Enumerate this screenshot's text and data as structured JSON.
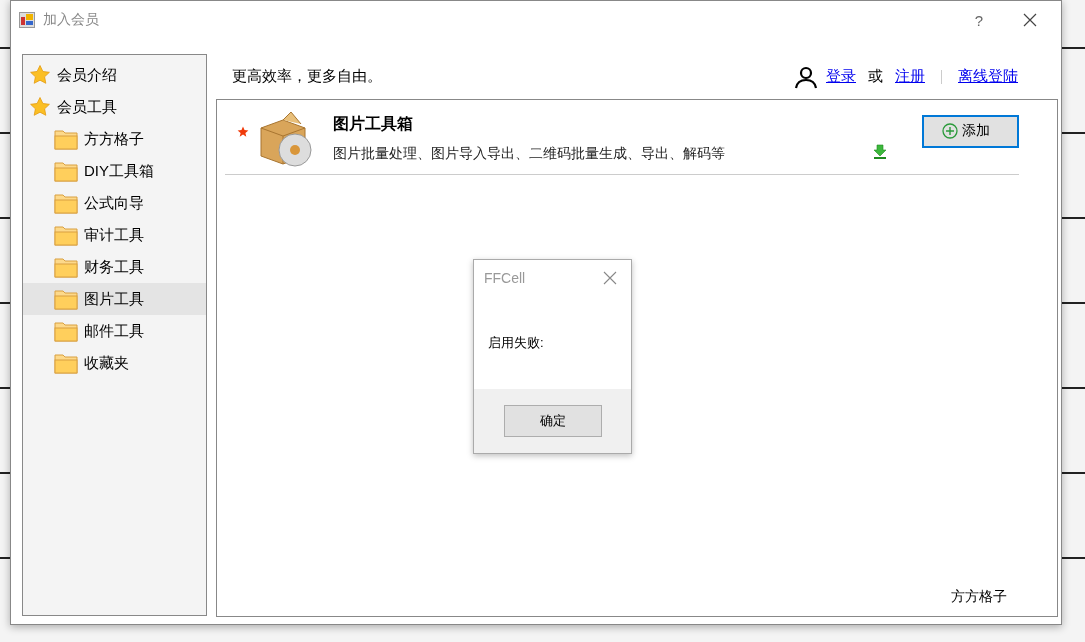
{
  "window": {
    "title": "加入会员",
    "help": "?"
  },
  "sidebar": {
    "items": [
      {
        "label": "会员介绍",
        "kind": "star",
        "selected": false
      },
      {
        "label": "会员工具",
        "kind": "star",
        "selected": false,
        "children": [
          {
            "label": "方方格子",
            "kind": "folder",
            "selected": false
          },
          {
            "label": "DIY工具箱",
            "kind": "folder",
            "selected": false
          },
          {
            "label": "公式向导",
            "kind": "folder",
            "selected": false
          },
          {
            "label": "审计工具",
            "kind": "folder",
            "selected": false
          },
          {
            "label": "财务工具",
            "kind": "folder",
            "selected": false
          },
          {
            "label": "图片工具",
            "kind": "folder",
            "selected": true
          },
          {
            "label": "邮件工具",
            "kind": "folder",
            "selected": false
          },
          {
            "label": "收藏夹",
            "kind": "folder",
            "selected": false
          }
        ]
      }
    ]
  },
  "header": {
    "slogan": "更高效率，更多自由。",
    "login": "登录",
    "or": "或",
    "register": "注册",
    "offline": "离线登陆"
  },
  "tools": [
    {
      "name": "图片工具箱",
      "description": "图片批量处理、图片导入导出、二维码批量生成、导出、解码等",
      "starred": true,
      "button": "添加"
    }
  ],
  "footer_label": "方方格子",
  "dialog": {
    "title": "FFCell",
    "message": "启用失败:",
    "button": "确定"
  }
}
